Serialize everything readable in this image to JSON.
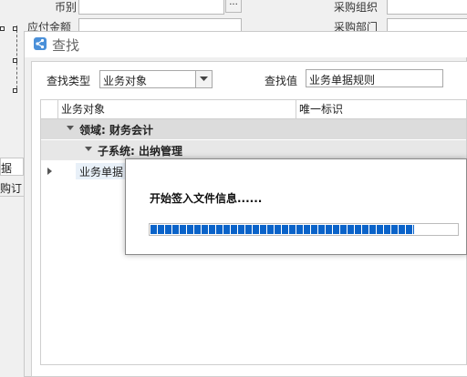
{
  "background": {
    "currency_label": "币别",
    "amount_label": "应付金额",
    "purchase_org_label": "采购组织",
    "purchase_dept_label": "采购部门",
    "ellipsis": "···",
    "left_tab_label": "据",
    "left_row_label": "购订"
  },
  "dialog": {
    "title": "查找",
    "search_type_label": "查找类型",
    "search_type_value": "业务对象",
    "search_value_label": "查找值",
    "search_value_value": "业务单据规则",
    "grid": {
      "columns": [
        "业务对象",
        "唯一标识"
      ],
      "group_domain": "领域: 财务会计",
      "group_subsystem": "子系统: 出纳管理",
      "row_text": "业务单据"
    }
  },
  "progress": {
    "message": "开始签入文件信息......",
    "value_percent": 86,
    "fill_color": "#0a63c9"
  }
}
